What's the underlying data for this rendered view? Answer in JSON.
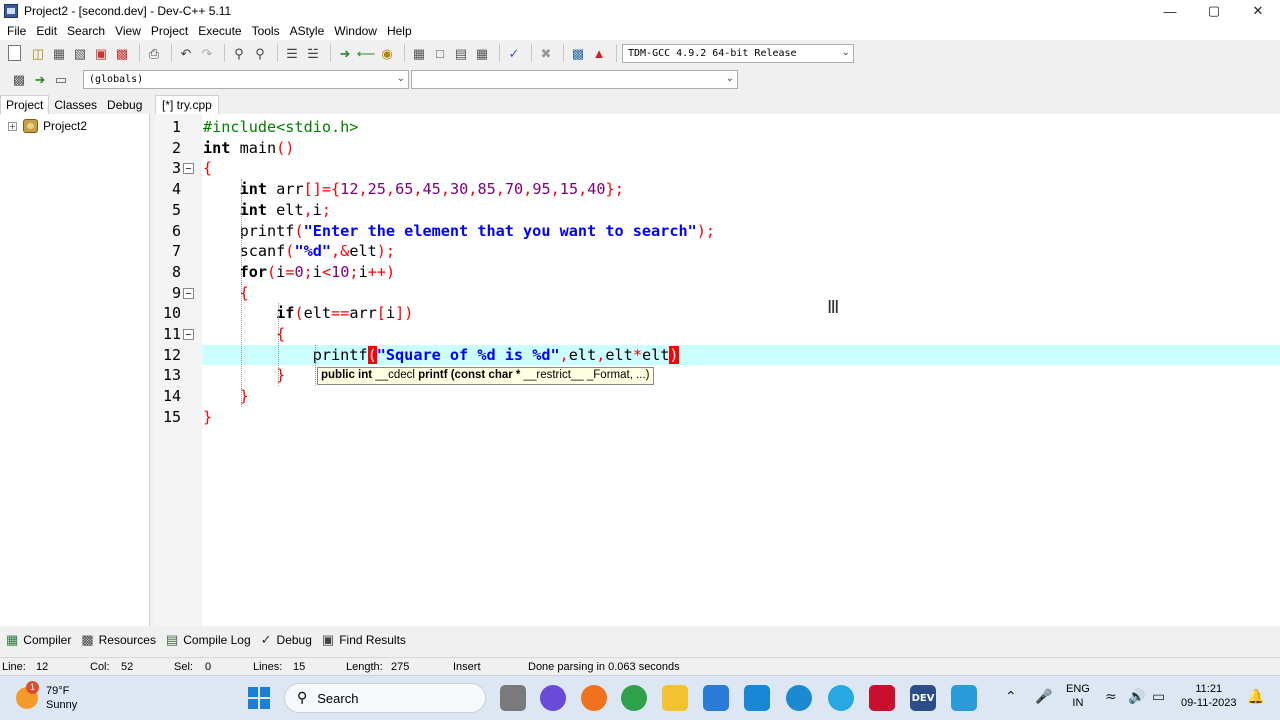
{
  "window": {
    "title": "Project2 - [second.dev] - Dev-C++ 5.11",
    "min": "—",
    "max": "▢",
    "close": "✕"
  },
  "menu": [
    "File",
    "Edit",
    "Search",
    "View",
    "Project",
    "Execute",
    "Tools",
    "AStyle",
    "Window",
    "Help"
  ],
  "toolbar": {
    "compiler": "TDM-GCC 4.9.2 64-bit Release",
    "scope": "(globals)",
    "member": ""
  },
  "left_tabs": [
    "Project",
    "Classes",
    "Debug"
  ],
  "project_tree": {
    "root": "Project2",
    "expander": "+"
  },
  "file_tab": "[*] try.cpp",
  "editor": {
    "line_numbers": [
      "1",
      "2",
      "3",
      "4",
      "5",
      "6",
      "7",
      "8",
      "9",
      "10",
      "11",
      "12",
      "13",
      "14",
      "15"
    ],
    "lines": [
      [
        [
          "pp",
          "#include<stdio.h>"
        ]
      ],
      [
        [
          "kw",
          "int"
        ],
        [
          "",
          " main"
        ],
        [
          "sym",
          "()"
        ]
      ],
      [
        [
          "sym",
          "{"
        ]
      ],
      [
        [
          "",
          "    "
        ],
        [
          "kw",
          "int"
        ],
        [
          "",
          " arr"
        ],
        [
          "sym",
          "[]={"
        ],
        [
          "num",
          "12"
        ],
        [
          "sym",
          ","
        ],
        [
          "num",
          "25"
        ],
        [
          "sym",
          ","
        ],
        [
          "num",
          "65"
        ],
        [
          "sym",
          ","
        ],
        [
          "num",
          "45"
        ],
        [
          "sym",
          ","
        ],
        [
          "num",
          "30"
        ],
        [
          "sym",
          ","
        ],
        [
          "num",
          "85"
        ],
        [
          "sym",
          ","
        ],
        [
          "num",
          "70"
        ],
        [
          "sym",
          ","
        ],
        [
          "num",
          "95"
        ],
        [
          "sym",
          ","
        ],
        [
          "num",
          "15"
        ],
        [
          "sym",
          ","
        ],
        [
          "num",
          "40"
        ],
        [
          "sym",
          "};"
        ]
      ],
      [
        [
          "",
          "    "
        ],
        [
          "kw",
          "int"
        ],
        [
          "",
          " elt"
        ],
        [
          "sym",
          ","
        ],
        [
          "",
          "i"
        ],
        [
          "sym",
          ";"
        ]
      ],
      [
        [
          "",
          "    printf"
        ],
        [
          "sym",
          "("
        ],
        [
          "str",
          "\"Enter the element that you want to search\""
        ],
        [
          "sym",
          ");"
        ]
      ],
      [
        [
          "",
          "    scanf"
        ],
        [
          "sym",
          "("
        ],
        [
          "str",
          "\"%d\""
        ],
        [
          "sym",
          ",&"
        ],
        [
          "",
          "elt"
        ],
        [
          "sym",
          ");"
        ]
      ],
      [
        [
          "",
          "    "
        ],
        [
          "kw",
          "for"
        ],
        [
          "sym",
          "("
        ],
        [
          "",
          "i"
        ],
        [
          "sym",
          "="
        ],
        [
          "num",
          "0"
        ],
        [
          "sym",
          ";"
        ],
        [
          "",
          "i"
        ],
        [
          "sym",
          "<"
        ],
        [
          "num",
          "10"
        ],
        [
          "sym",
          ";"
        ],
        [
          "",
          "i"
        ],
        [
          "sym",
          "++)"
        ]
      ],
      [
        [
          "",
          "    "
        ],
        [
          "sym",
          "{"
        ]
      ],
      [
        [
          "",
          "        "
        ],
        [
          "kw",
          "if"
        ],
        [
          "sym",
          "("
        ],
        [
          "",
          "elt"
        ],
        [
          "sym",
          "=="
        ],
        [
          "",
          "arr"
        ],
        [
          "sym",
          "["
        ],
        [
          "",
          "i"
        ],
        [
          "sym",
          "])"
        ]
      ],
      [
        [
          "",
          "        "
        ],
        [
          "sym",
          "{"
        ]
      ],
      [
        [
          "",
          "            printf"
        ],
        [
          "hl",
          "("
        ],
        [
          "str",
          "\"Square of %d is %d\""
        ],
        [
          "sym",
          ","
        ],
        [
          "",
          "elt"
        ],
        [
          "sym",
          ","
        ],
        [
          "",
          "elt"
        ],
        [
          "sym",
          "*"
        ],
        [
          "",
          "elt"
        ],
        [
          "hl",
          ")"
        ]
      ],
      [
        [
          "",
          "        "
        ],
        [
          "sym",
          "}"
        ]
      ],
      [
        [
          "",
          "    "
        ],
        [
          "sym",
          "}"
        ]
      ],
      [
        [
          "sym",
          "}"
        ]
      ]
    ],
    "calltip": {
      "bold_prefix": "public int ",
      "mid": "__cdecl ",
      "bold_mid": "printf (const char * ",
      "rest": "__restrict__ _Format, ...)"
    }
  },
  "bottom_tabs": [
    "Compiler",
    "Resources",
    "Compile Log",
    "Debug",
    "Find Results"
  ],
  "status": {
    "line_label": "Line:",
    "line": "12",
    "col_label": "Col:",
    "col": "52",
    "sel_label": "Sel:",
    "sel": "0",
    "lines_label": "Lines:",
    "lines": "15",
    "length_label": "Length:",
    "length": "275",
    "mode": "Insert",
    "message": "Done parsing in 0.063 seconds"
  },
  "taskbar": {
    "temperature": "79°F",
    "condition": "Sunny",
    "badge": "1",
    "search": "Search",
    "lang_top": "ENG",
    "lang_bottom": "IN",
    "time": "11:21",
    "date": "09-11-2023"
  },
  "colors": {
    "current_line": "#ccffff",
    "keyword": "#000000",
    "preprocessor": "#008000",
    "symbol": "#ff0000",
    "number": "#800080",
    "string": "#0000ff"
  }
}
